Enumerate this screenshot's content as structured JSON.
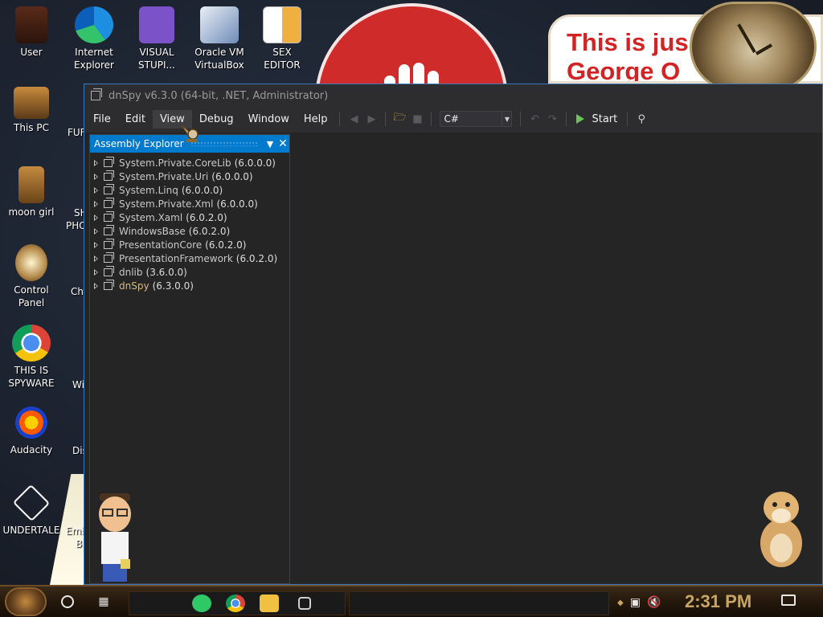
{
  "desktop": {
    "icons": [
      {
        "label": "User"
      },
      {
        "label": "Internet\nExplorer"
      },
      {
        "label": "VISUAL\nSTUPI..."
      },
      {
        "label": "Oracle VM\nVirtualBox"
      },
      {
        "label": "SEX\nEDITOR"
      },
      {
        "label": "This PC"
      },
      {
        "label": "moon girl"
      },
      {
        "label": "Control Panel"
      },
      {
        "label": "THIS IS\nSPYWARE"
      },
      {
        "label": "Audacity"
      },
      {
        "label": "UNDERTALE"
      }
    ],
    "partial_labels": [
      "FUF",
      "SH",
      "PHO",
      "Cho",
      "Wi",
      "Dis",
      "Emb",
      "Ba"
    ],
    "wallpaper_text": [
      "This is jus",
      "George O"
    ]
  },
  "window": {
    "title": "dnSpy v6.3.0 (64-bit, .NET, Administrator)",
    "menu": [
      "File",
      "Edit",
      "View",
      "Debug",
      "Window",
      "Help"
    ],
    "language": "C#",
    "start_label": "Start"
  },
  "assembly_explorer": {
    "title": "Assembly Explorer",
    "items": [
      {
        "name": "System.Private.CoreLib",
        "version": "(6.0.0.0)"
      },
      {
        "name": "System.Private.Uri",
        "version": "(6.0.0.0)"
      },
      {
        "name": "System.Linq",
        "version": "(6.0.0.0)"
      },
      {
        "name": "System.Private.Xml",
        "version": "(6.0.0.0)"
      },
      {
        "name": "System.Xaml",
        "version": "(6.0.2.0)"
      },
      {
        "name": "WindowsBase",
        "version": "(6.0.2.0)"
      },
      {
        "name": "PresentationCore",
        "version": "(6.0.2.0)"
      },
      {
        "name": "PresentationFramework",
        "version": "(6.0.2.0)"
      },
      {
        "name": "dnlib",
        "version": "(3.6.0.0)"
      },
      {
        "name": "dnSpy",
        "version": "(6.3.0.0)"
      }
    ]
  },
  "taskbar": {
    "clock": "2:31 PM"
  },
  "colors": {
    "accent": "#007acc",
    "window_border": "#3b79c0",
    "clock": "#c8a560",
    "sign_text": "#d22424"
  }
}
